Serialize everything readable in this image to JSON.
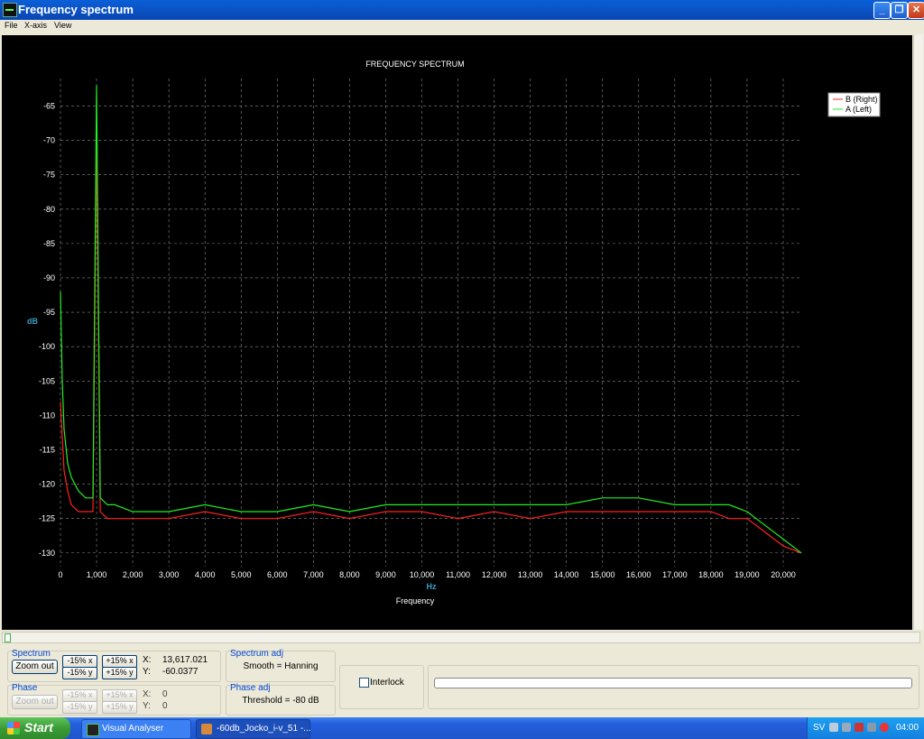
{
  "window": {
    "title": "Frequency spectrum",
    "controls": {
      "minimize": "_",
      "maximize": "❐",
      "close": "✕"
    }
  },
  "menu": [
    "File",
    "X-axis",
    "View"
  ],
  "chart_data": {
    "type": "line",
    "title": "FREQUENCY SPECTRUM",
    "xlabel": "Frequency",
    "xunit": "Hz",
    "ylabel": "dB",
    "xlim": [
      0,
      20500
    ],
    "ylim": [
      -132,
      -61
    ],
    "grid": true,
    "legend_position": "top-right",
    "xticks": [
      0,
      1000,
      2000,
      3000,
      4000,
      5000,
      6000,
      7000,
      8000,
      9000,
      10000,
      11000,
      12000,
      13000,
      14000,
      15000,
      16000,
      17000,
      18000,
      19000,
      20000
    ],
    "xtick_labels": [
      "0",
      "1,000",
      "2,000",
      "3,000",
      "4,000",
      "5,000",
      "6,000",
      "7,000",
      "8,000",
      "9,000",
      "10,000",
      "11,000",
      "12,000",
      "13,000",
      "14,000",
      "15,000",
      "16,000",
      "17,000",
      "18,000",
      "19,000",
      "20,000"
    ],
    "yticks": [
      -65,
      -70,
      -75,
      -80,
      -85,
      -90,
      -95,
      -100,
      -105,
      -110,
      -115,
      -120,
      -125,
      -130
    ],
    "series": [
      {
        "name": "B (Right)",
        "color": "#ff2020",
        "x": [
          0,
          50,
          100,
          200,
          300,
          500,
          700,
          900,
          1000,
          1100,
          1300,
          1500,
          2000,
          3000,
          4000,
          5000,
          6000,
          7000,
          8000,
          9000,
          10000,
          11000,
          12000,
          13000,
          14000,
          15000,
          16000,
          17000,
          18000,
          18500,
          19000,
          19500,
          20000,
          20500
        ],
        "y": [
          -108,
          -113,
          -118,
          -121,
          -123,
          -124,
          -124,
          -124,
          -69,
          -124,
          -125,
          -125,
          -125,
          -125,
          -124,
          -125,
          -125,
          -124,
          -125,
          -124,
          -124,
          -125,
          -124,
          -125,
          -124,
          -124,
          -124,
          -124,
          -124,
          -125,
          -125,
          -127,
          -129,
          -130
        ]
      },
      {
        "name": "A (Left)",
        "color": "#22ee22",
        "x": [
          0,
          50,
          100,
          200,
          300,
          500,
          700,
          900,
          1000,
          1100,
          1300,
          1500,
          2000,
          3000,
          4000,
          5000,
          6000,
          7000,
          8000,
          9000,
          10000,
          11000,
          12000,
          13000,
          14000,
          15000,
          16000,
          17000,
          18000,
          18500,
          19000,
          19500,
          20000,
          20500
        ],
        "y": [
          -92,
          -105,
          -112,
          -117,
          -119,
          -121,
          -122,
          -122,
          -62,
          -122,
          -123,
          -123,
          -124,
          -124,
          -123,
          -124,
          -124,
          -123,
          -124,
          -123,
          -123,
          -123,
          -123,
          -123,
          -123,
          -122,
          -122,
          -123,
          -123,
          -123,
          -124,
          -126,
          -128,
          -130
        ]
      }
    ]
  },
  "spectrum": {
    "label": "Spectrum",
    "zoom_out": "Zoom out",
    "minus_x": "-15% x",
    "plus_x": "+15% x",
    "minus_y": "-15% y",
    "plus_y": "+15% y",
    "x_label": "X:",
    "x_value": "13,617.021",
    "y_label": "Y:",
    "y_value": "-60.0377"
  },
  "phase": {
    "label": "Phase",
    "zoom_out": "Zoom out",
    "minus_x": "-15% x",
    "plus_x": "+15% x",
    "minus_y": "-15% y",
    "plus_y": "+15% y",
    "x_label": "X:",
    "x_value": "0",
    "y_label": "Y:",
    "y_value": "0"
  },
  "spectrum_adj": {
    "label": "Spectrum adj",
    "text": "Smooth = Hanning"
  },
  "phase_adj": {
    "label": "Phase adj",
    "text": "Threshold = -80 dB"
  },
  "interlock": {
    "label": "Interlock",
    "checked": false
  },
  "taskbar": {
    "start": "Start",
    "tasks": [
      "Visual Analyser",
      "-60db_Jocko_i-v_51 -..."
    ],
    "tray": {
      "lang": "SV",
      "clock": "04:00"
    }
  }
}
